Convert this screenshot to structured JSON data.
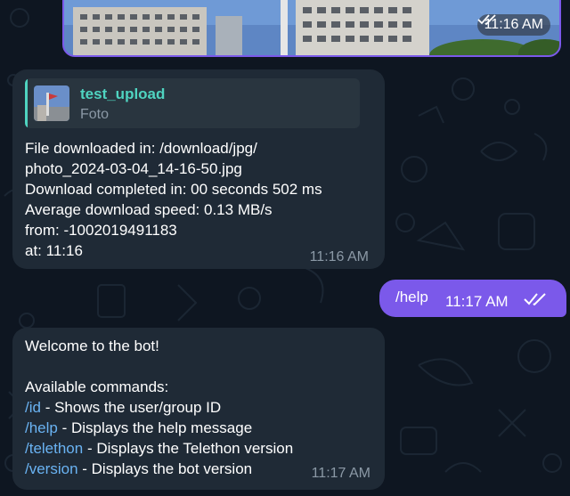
{
  "top_photo": {
    "time": "11:16 AM"
  },
  "msg1": {
    "reply": {
      "title": "test_upload",
      "subtitle": "Foto"
    },
    "lines": [
      "File downloaded in: /download/jpg/",
      "photo_2024-03-04_14-16-50.jpg",
      "Download completed in: 00 seconds 502 ms",
      "Average download speed: 0.13 MB/s",
      "from: -1002019491183",
      "at: 11:16"
    ],
    "time": "11:16 AM"
  },
  "msg2": {
    "text": "/help",
    "time": "11:17 AM"
  },
  "msg3": {
    "greeting": "Welcome to the bot!",
    "header": "Available commands:",
    "commands": [
      {
        "cmd": "/id",
        "desc": " - Shows the user/group ID"
      },
      {
        "cmd": "/help",
        "desc": " - Displays the help message"
      },
      {
        "cmd": "/telethon",
        "desc": " - Displays the Telethon version"
      },
      {
        "cmd": "/version",
        "desc": " - Displays the bot version"
      }
    ],
    "time": "11:17 AM"
  },
  "colors": {
    "background": "#0e1621",
    "incoming": "#1f2a36",
    "outgoing": "#7b59ea",
    "link": "#6ab3f3",
    "accent": "#4fd3c0"
  }
}
